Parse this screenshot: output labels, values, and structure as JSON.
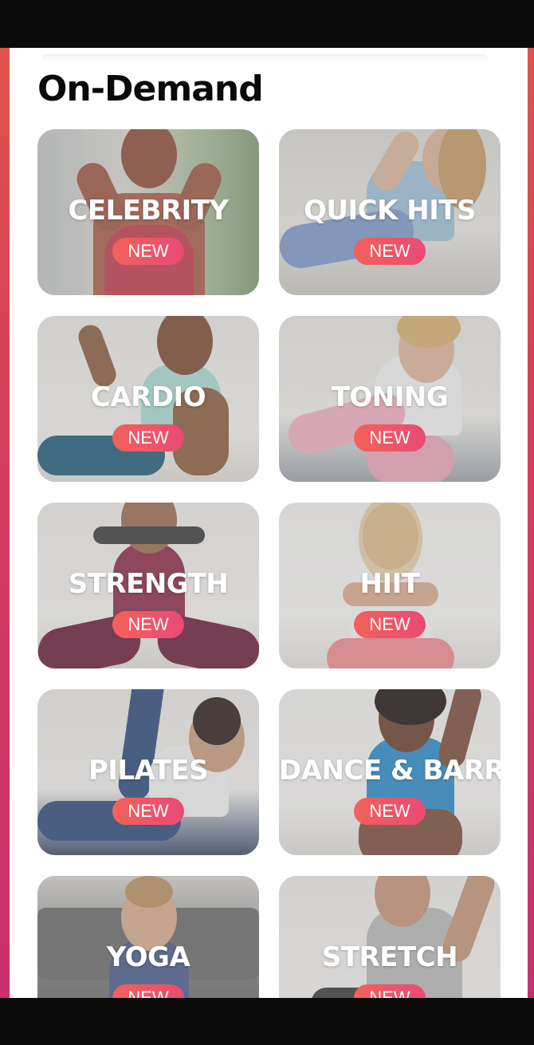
{
  "page": {
    "title": "On-Demand"
  },
  "categories": [
    {
      "label": "CELEBRITY",
      "badge": "NEW"
    },
    {
      "label": "QUICK HITS",
      "badge": "NEW"
    },
    {
      "label": "CARDIO",
      "badge": "NEW"
    },
    {
      "label": "TONING",
      "badge": "NEW"
    },
    {
      "label": "STRENGTH",
      "badge": "NEW"
    },
    {
      "label": "HIIT",
      "badge": "NEW"
    },
    {
      "label": "PILATES",
      "badge": "NEW"
    },
    {
      "label": "DANCE & BARRE",
      "badge": "NEW"
    },
    {
      "label": "YOGA",
      "badge": "NEW"
    },
    {
      "label": "STRETCH",
      "badge": "NEW"
    }
  ],
  "colors": {
    "accent_start": "#f2625a",
    "accent_end": "#ea4a74",
    "frame": "#d43c5e"
  }
}
